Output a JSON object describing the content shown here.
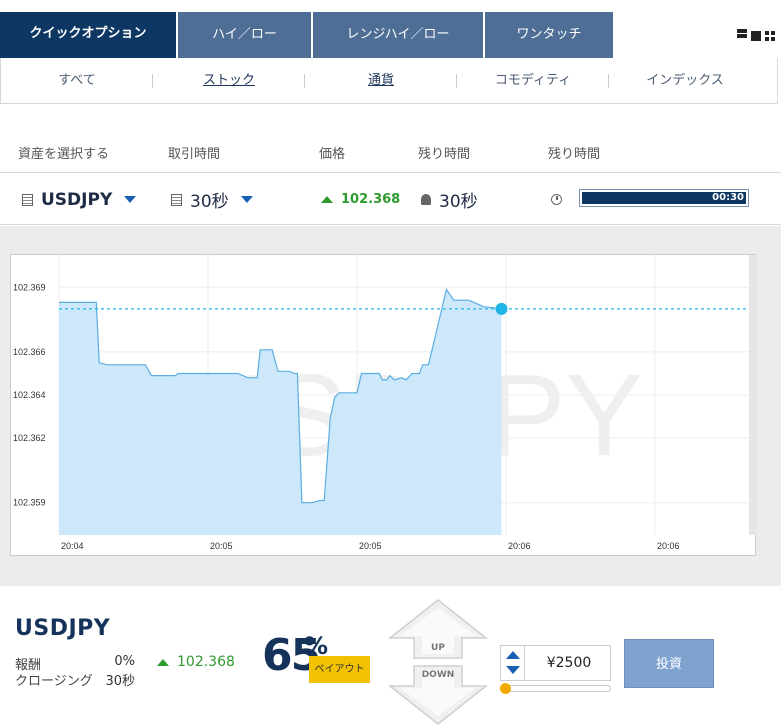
{
  "tabs": [
    {
      "label": "クイックオプション",
      "active": true
    },
    {
      "label": "ハイ／ロー",
      "active": false
    },
    {
      "label": "レンジハイ／ロー",
      "active": false
    },
    {
      "label": "ワンタッチ",
      "active": false
    }
  ],
  "view_toggle": [
    "list-view-icon",
    "tile-view-icon",
    "grid-view-icon"
  ],
  "subnav": [
    "すべて",
    "ストック",
    "通貨",
    "コモディティ",
    "インデックス"
  ],
  "headers": {
    "asset": "資産を選択する",
    "trade_time": "取引時間",
    "price": "価格",
    "remaining1": "残り時間",
    "remaining2": "残り時間"
  },
  "asset_row": {
    "asset": "USDJPY",
    "trade_time": "30秒",
    "price": "102.368",
    "remaining": "30秒",
    "countdown": "00:30",
    "countdown_fraction": 1.0
  },
  "chart_data": {
    "type": "line",
    "watermark": "USDJPY",
    "fill_color": "#cde8fb",
    "line_color": "#5aaee0",
    "ref_line_color": "#1eb4e6",
    "y_ticks": [
      "102.369",
      "102.366",
      "102.364",
      "102.362",
      "102.359"
    ],
    "x_ticks": [
      "20:04",
      "20:05",
      "20:05",
      "20:06",
      "20:06"
    ],
    "ylim": [
      102.3575,
      102.3705
    ],
    "current": 102.368,
    "points": [
      [
        0,
        102.3683
      ],
      [
        0.25,
        102.3683
      ],
      [
        0.27,
        102.3655
      ],
      [
        0.32,
        102.3654
      ],
      [
        0.58,
        102.3654
      ],
      [
        0.62,
        102.3649
      ],
      [
        0.78,
        102.3649
      ],
      [
        0.8,
        102.365
      ],
      [
        1.2,
        102.365
      ],
      [
        1.27,
        102.3648
      ],
      [
        1.33,
        102.3648
      ],
      [
        1.35,
        102.3661
      ],
      [
        1.43,
        102.3661
      ],
      [
        1.47,
        102.3651
      ],
      [
        1.55,
        102.3651
      ],
      [
        1.58,
        102.365
      ],
      [
        1.6,
        102.365
      ],
      [
        1.63,
        102.359
      ],
      [
        1.68,
        102.359
      ],
      [
        1.7,
        102.359
      ],
      [
        1.75,
        102.3591
      ],
      [
        1.78,
        102.3591
      ],
      [
        1.82,
        102.3629
      ],
      [
        1.85,
        102.3639
      ],
      [
        1.88,
        102.3641
      ],
      [
        1.93,
        102.3641
      ],
      [
        2.0,
        102.3641
      ],
      [
        2.03,
        102.365
      ],
      [
        2.07,
        102.365
      ],
      [
        2.15,
        102.365
      ],
      [
        2.17,
        102.3647
      ],
      [
        2.2,
        102.3647
      ],
      [
        2.22,
        102.3649
      ],
      [
        2.25,
        102.3647
      ],
      [
        2.3,
        102.3648
      ],
      [
        2.33,
        102.3647
      ],
      [
        2.37,
        102.365
      ],
      [
        2.42,
        102.365
      ],
      [
        2.44,
        102.3654
      ],
      [
        2.48,
        102.3654
      ],
      [
        2.6,
        102.3689
      ],
      [
        2.65,
        102.3684
      ],
      [
        2.75,
        102.3684
      ],
      [
        2.85,
        102.3681
      ],
      [
        2.97,
        102.368
      ]
    ],
    "x_tick_positions": [
      0,
      1,
      2,
      3,
      4
    ]
  },
  "bottom": {
    "asset": "USDJPY",
    "reward_label": "報酬",
    "reward_value": "0%",
    "closing_label": "クロージング",
    "closing_value": "30秒",
    "price": "102.368",
    "payout_pct": "65",
    "payout_sign": "%",
    "payout_label": "ペイアウト",
    "up_label": "UP",
    "down_label": "DOWN",
    "amount": "¥2500",
    "invest_label": "投資"
  }
}
